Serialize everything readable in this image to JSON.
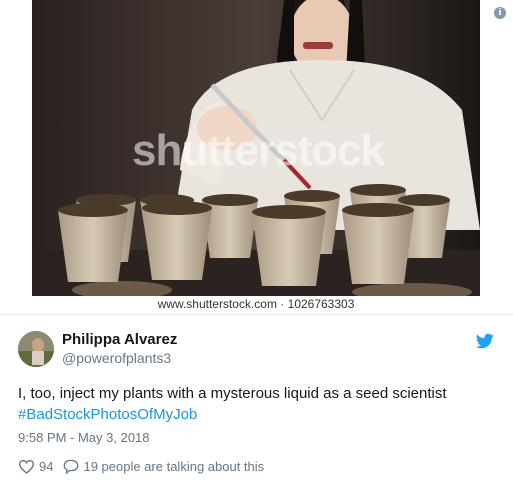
{
  "media": {
    "watermark": "shutterstock",
    "caption": "www.shutterstock.com · 1026763303"
  },
  "author": {
    "name": "Philippa Alvarez",
    "handle": "@powerofplants3"
  },
  "tweet": {
    "text": "I, too, inject my plants with a mysterous liquid as a seed scientist",
    "hashtag": "#BadStockPhotosOfMyJob",
    "timestamp": "9:58 PM - May 3, 2018"
  },
  "engagement": {
    "likes": "94",
    "replies_text": "19 people are talking about this"
  },
  "icons": {
    "info": "info-icon",
    "brand": "twitter-bird-icon",
    "like": "heart-icon",
    "reply": "comment-bubble-icon"
  },
  "colors": {
    "accent": "#1b95e0",
    "muted": "#657786",
    "text": "#14171a"
  }
}
